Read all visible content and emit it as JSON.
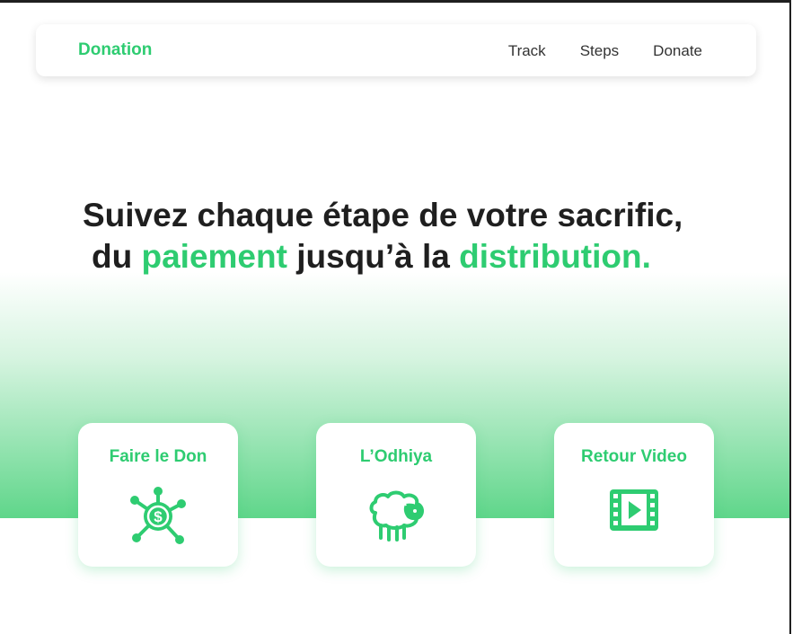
{
  "navbar": {
    "brand": "Donation",
    "links": [
      "Track",
      "Steps",
      "Donate"
    ]
  },
  "hero": {
    "line1": "Suivez chaque étape de votre sacrific,",
    "line2_prefix": "du",
    "line2_accent1": "paiement",
    "line2_middle": "jusqu’à la",
    "line2_accent2": "distribution."
  },
  "cards": [
    {
      "title": "Faire le Don",
      "icon": "donation-network-icon"
    },
    {
      "title": "L’Odhiya",
      "icon": "sheep-icon"
    },
    {
      "title": "Retour Video",
      "icon": "video-film-icon"
    }
  ],
  "colors": {
    "accent": "#2ecc71",
    "text": "#1f1f1f"
  }
}
